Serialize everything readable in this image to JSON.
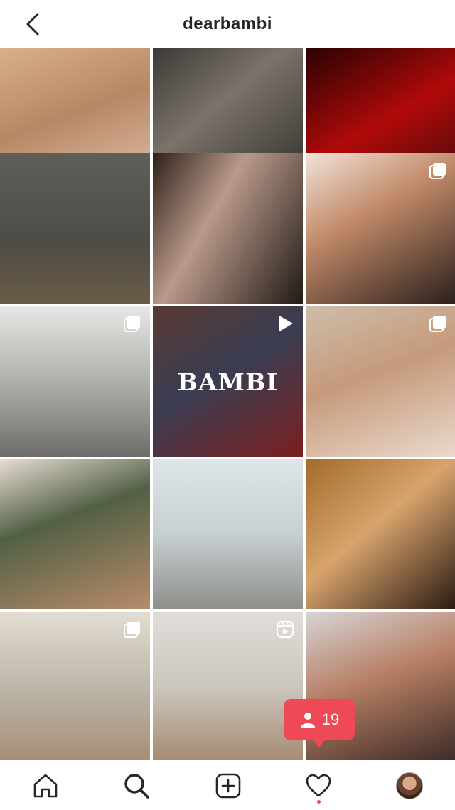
{
  "header": {
    "title": "dearbambi",
    "back_icon": "chevron-left-icon"
  },
  "grid": {
    "posts": [
      {
        "type": "image",
        "badge": null,
        "overlay_text": ""
      },
      {
        "type": "image",
        "badge": null,
        "overlay_text": ""
      },
      {
        "type": "image",
        "badge": null,
        "overlay_text": ""
      },
      {
        "type": "image",
        "badge": null,
        "overlay_text": ""
      },
      {
        "type": "image",
        "badge": null,
        "overlay_text": ""
      },
      {
        "type": "carousel",
        "badge": "carousel-icon",
        "overlay_text": ""
      },
      {
        "type": "carousel",
        "badge": "carousel-icon",
        "overlay_text": ""
      },
      {
        "type": "video",
        "badge": "play-icon",
        "overlay_text": "BAMBI"
      },
      {
        "type": "carousel",
        "badge": "carousel-icon",
        "overlay_text": ""
      },
      {
        "type": "image",
        "badge": null,
        "overlay_text": ""
      },
      {
        "type": "image",
        "badge": null,
        "overlay_text": ""
      },
      {
        "type": "image",
        "badge": null,
        "overlay_text": ""
      },
      {
        "type": "carousel",
        "badge": "carousel-icon",
        "overlay_text": ""
      },
      {
        "type": "reel",
        "badge": "reels-icon",
        "overlay_text": ""
      },
      {
        "type": "image",
        "badge": null,
        "overlay_text": ""
      }
    ]
  },
  "toast": {
    "icon": "person-icon",
    "count": "19",
    "color": "#ed4956"
  },
  "tabbar": {
    "items": [
      {
        "name": "home",
        "icon": "home-icon"
      },
      {
        "name": "search",
        "icon": "search-icon"
      },
      {
        "name": "create",
        "icon": "plus-square-icon"
      },
      {
        "name": "activity",
        "icon": "heart-icon"
      },
      {
        "name": "profile",
        "icon": "avatar"
      }
    ]
  }
}
